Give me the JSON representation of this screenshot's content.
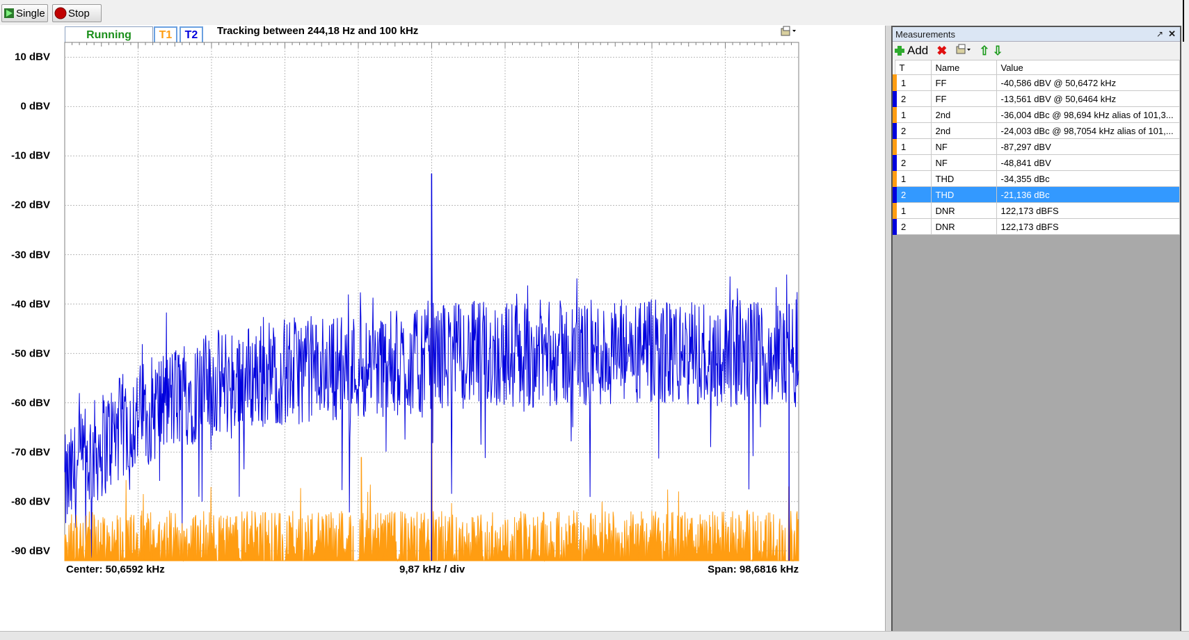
{
  "toolbar": {
    "single_label": "Single",
    "stop_label": "Stop"
  },
  "plot": {
    "status": "Running",
    "trace1": "T1",
    "trace2": "T2",
    "tracking_text": "Tracking between 244,18 Hz and 100 kHz",
    "center_text": "Center: 50,6592 kHz",
    "div_text": "9,87 kHz / div",
    "span_text": "Span: 98,6816 kHz",
    "y_labels": [
      "10 dBV",
      "0 dBV",
      "-10 dBV",
      "-20 dBV",
      "-30 dBV",
      "-40 dBV",
      "-50 dBV",
      "-60 dBV",
      "-70 dBV",
      "-80 dBV",
      "-90 dBV"
    ]
  },
  "colors": {
    "trace1": "#ff9d12",
    "trace2": "#0000dd",
    "status": "#1a8f1a",
    "selection": "#3399ff"
  },
  "chart_data": {
    "type": "line",
    "xlabel": "",
    "ylabel": "",
    "x_range_khz": [
      1.318,
      100.0
    ],
    "ylim": [
      -92,
      13
    ],
    "y_ticks": [
      10,
      0,
      -10,
      -20,
      -30,
      -40,
      -50,
      -60,
      -70,
      -80,
      -90
    ],
    "grid": true,
    "series": [
      {
        "name": "T1",
        "color": "#ff9d12",
        "noise_floor_dbv": -87.3,
        "peaks": [
          {
            "x_khz": 41.2,
            "y_dbv": -71
          },
          {
            "x_khz": 50.6472,
            "y_dbv": -40.586
          },
          {
            "x_khz": 98.694,
            "y_dbv": -77
          }
        ]
      },
      {
        "name": "T2",
        "color": "#0000dd",
        "noise_floor_dbv": -48.8,
        "peaks": [
          {
            "x_khz": 50.6464,
            "y_dbv": -13.561
          },
          {
            "x_khz": 98.7054,
            "y_dbv": -40
          }
        ]
      }
    ]
  },
  "measurements": {
    "title": "Measurements",
    "add_label": "Add",
    "columns": [
      "T",
      "Name",
      "Value"
    ],
    "rows": [
      {
        "t": "1",
        "name": "FF",
        "value": "-40,586 dBV @ 50,6472 kHz"
      },
      {
        "t": "2",
        "name": "FF",
        "value": "-13,561 dBV @ 50,6464 kHz"
      },
      {
        "t": "1",
        "name": "2nd",
        "value": "-36,004 dBc @ 98,694 kHz alias of 101,3..."
      },
      {
        "t": "2",
        "name": "2nd",
        "value": "-24,003 dBc @ 98,7054 kHz alias of 101,..."
      },
      {
        "t": "1",
        "name": "NF",
        "value": "-87,297 dBV"
      },
      {
        "t": "2",
        "name": "NF",
        "value": "-48,841 dBV"
      },
      {
        "t": "1",
        "name": "THD",
        "value": "-34,355 dBc"
      },
      {
        "t": "2",
        "name": "THD",
        "value": "-21,136 dBc"
      },
      {
        "t": "1",
        "name": "DNR",
        "value": "122,173 dBFS"
      },
      {
        "t": "2",
        "name": "DNR",
        "value": "122,173 dBFS"
      }
    ]
  }
}
